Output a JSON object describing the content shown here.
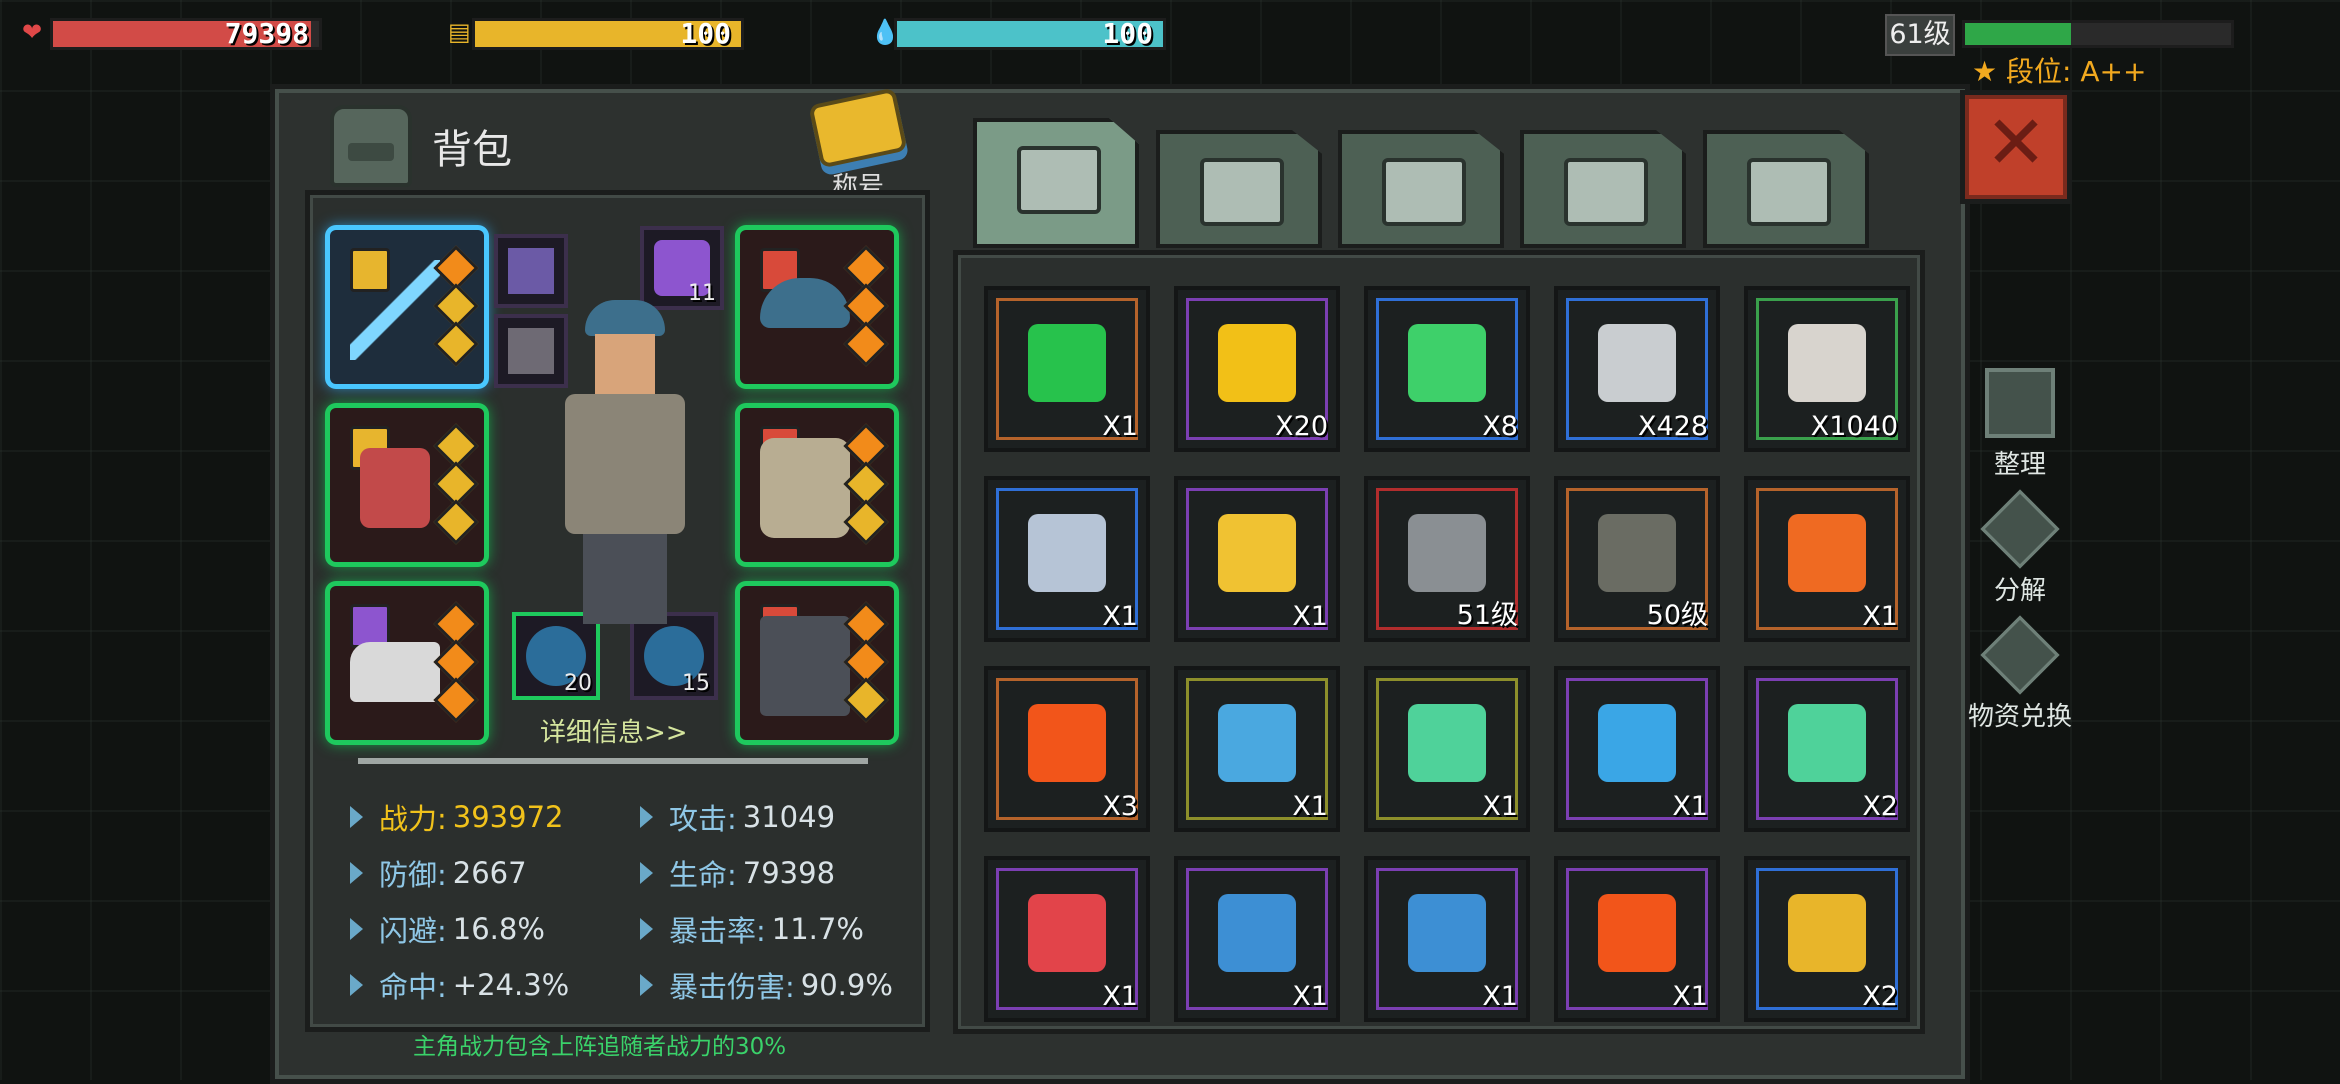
{
  "hud": {
    "hp": {
      "value": "79398",
      "fill": 0.97,
      "color": "#d24b47"
    },
    "energy": {
      "value": "100",
      "fill": 1.0,
      "color": "#e8b52a"
    },
    "water": {
      "value": "100",
      "fill": 1.0,
      "color": "#4cc2c9"
    },
    "level": {
      "label": "61级",
      "fill": 0.4,
      "color": "#2fa748"
    },
    "rank": "段位: A++"
  },
  "backpack": {
    "title": "背包",
    "badge_label": "称号",
    "detail_link": "详细信息>>",
    "mini_counts": [
      "11",
      "20",
      "15"
    ],
    "stats": {
      "power_label": "战力:",
      "power": "393972",
      "attack_label": "攻击:",
      "attack": "31049",
      "defense_label": "防御:",
      "defense": "2667",
      "life_label": "生命:",
      "life": "79398",
      "dodge_label": "闪避:",
      "dodge": "16.8%",
      "crit_label": "暴击率:",
      "crit": "11.7%",
      "hit_label": "命中:",
      "hit": "+24.3%",
      "crit_dmg_label": "暴击伤害:",
      "crit_dmg": "90.9%"
    },
    "footer_note": "主角战力包含上阵追随者战力的30%"
  },
  "tabs": [
    "backpack-icon",
    "medkit-icon",
    "armor-icon",
    "gun-icon",
    "tools-icon"
  ],
  "items": [
    {
      "name": "sale-coupon",
      "count": "X1",
      "color": "#27c24c",
      "frame": "#b5632b"
    },
    {
      "name": "gold-coin",
      "count": "X20",
      "color": "#f2c017",
      "frame": "#7b3fb2"
    },
    {
      "name": "cocktail",
      "count": "X8",
      "color": "#3ed06a",
      "frame": "#2f6fd6"
    },
    {
      "name": "silver-coin",
      "count": "X428",
      "color": "#c9cdd0",
      "frame": "#2f6fd6"
    },
    {
      "name": "eagle-emblem",
      "count": "X1040",
      "color": "#d8d4ce",
      "frame": "#3aa04c"
    },
    {
      "name": "map",
      "count": "X1",
      "color": "#b6c4d6",
      "frame": "#2f6fd6"
    },
    {
      "name": "supply-crate",
      "count": "X1",
      "color": "#f0c232",
      "frame": "#7b3fb2"
    },
    {
      "name": "pistol",
      "count": "51级",
      "color": "#8a8f93",
      "frame": "#b22d2d"
    },
    {
      "name": "rifle",
      "count": "50级",
      "color": "#6a6c63",
      "frame": "#b5632b"
    },
    {
      "name": "portrait-card",
      "count": "X1",
      "color": "#ef6a22",
      "frame": "#b5632b"
    },
    {
      "name": "fire-grenade",
      "count": "X3",
      "color": "#f2551a",
      "frame": "#b5632b"
    },
    {
      "name": "blueprint-chip",
      "count": "X1",
      "color": "#4aa8e0",
      "frame": "#8d8f2b"
    },
    {
      "name": "green-card",
      "count": "X1",
      "color": "#4fd29a",
      "frame": "#8d8f2b"
    },
    {
      "name": "scanner-card",
      "count": "X1",
      "color": "#3aa6e6",
      "frame": "#7b3fb2"
    },
    {
      "name": "green-card-2",
      "count": "X2",
      "color": "#4fd29a",
      "frame": "#7b3fb2"
    },
    {
      "name": "red-gun-card",
      "count": "X1",
      "color": "#e2444a",
      "frame": "#7b3fb2"
    },
    {
      "name": "blue-chip",
      "count": "X1",
      "color": "#3d8fd4",
      "frame": "#7b3fb2"
    },
    {
      "name": "blue-chip-2",
      "count": "X1",
      "color": "#3d8fd4",
      "frame": "#7b3fb2"
    },
    {
      "name": "fire-grenade-2",
      "count": "X1",
      "color": "#f2551a",
      "frame": "#7b3fb2"
    },
    {
      "name": "gold-chip",
      "count": "X2",
      "color": "#e8b52a",
      "frame": "#2f6fd6"
    }
  ],
  "side_actions": {
    "sort": "整理",
    "decompose": "分解",
    "exchange": "物资兑换"
  }
}
